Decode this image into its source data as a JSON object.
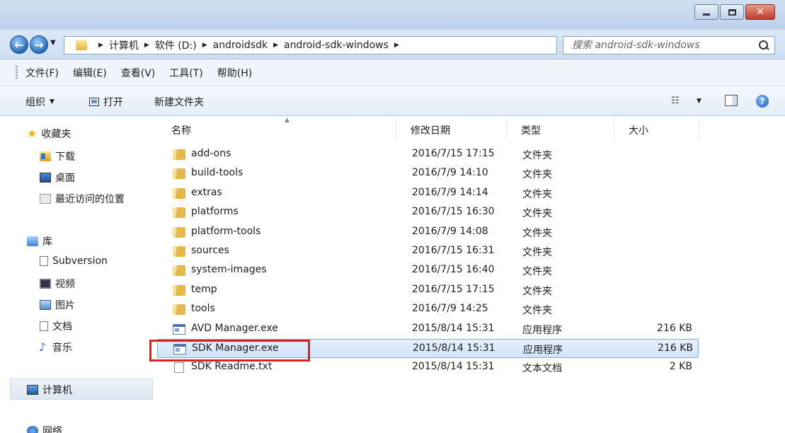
{
  "window": {
    "minimize": "–",
    "maximize": "□",
    "close": "✕"
  },
  "address": {
    "crumbs": [
      "计算机",
      "软件 (D:)",
      "androidsdk",
      "android-sdk-windows"
    ],
    "search_placeholder": "搜索 android-sdk-windows"
  },
  "menu": [
    "文件(F)",
    "编辑(E)",
    "查看(V)",
    "工具(T)",
    "帮助(H)"
  ],
  "toolbar": {
    "organize": "组织",
    "open": "打开",
    "new_folder": "新建文件夹",
    "help": "?"
  },
  "nav": {
    "favorites": "收藏夹",
    "downloads": "下载",
    "desktop": "桌面",
    "recent": "最近访问的位置",
    "libraries": "库",
    "subversion": "Subversion",
    "videos": "视频",
    "pictures": "图片",
    "documents": "文档",
    "music": "音乐",
    "computer": "计算机",
    "network": "网络"
  },
  "columns": {
    "name": "名称",
    "date": "修改日期",
    "type": "类型",
    "size": "大小"
  },
  "files": [
    {
      "icon": "folder-icon",
      "name": "add-ons",
      "date": "2016/7/15 17:15",
      "type": "文件夹",
      "size": ""
    },
    {
      "icon": "folder-icon",
      "name": "build-tools",
      "date": "2016/7/9 14:10",
      "type": "文件夹",
      "size": ""
    },
    {
      "icon": "folder-icon",
      "name": "extras",
      "date": "2016/7/9 14:14",
      "type": "文件夹",
      "size": ""
    },
    {
      "icon": "folder-icon",
      "name": "platforms",
      "date": "2016/7/15 16:30",
      "type": "文件夹",
      "size": ""
    },
    {
      "icon": "folder-icon",
      "name": "platform-tools",
      "date": "2016/7/9 14:08",
      "type": "文件夹",
      "size": ""
    },
    {
      "icon": "folder-icon",
      "name": "sources",
      "date": "2016/7/15 16:31",
      "type": "文件夹",
      "size": ""
    },
    {
      "icon": "folder-icon",
      "name": "system-images",
      "date": "2016/7/15 16:40",
      "type": "文件夹",
      "size": ""
    },
    {
      "icon": "folder-icon",
      "name": "temp",
      "date": "2016/7/15 17:15",
      "type": "文件夹",
      "size": ""
    },
    {
      "icon": "folder-icon",
      "name": "tools",
      "date": "2016/7/9 14:25",
      "type": "文件夹",
      "size": ""
    },
    {
      "icon": "exe-icon",
      "name": "AVD Manager.exe",
      "date": "2015/8/14 15:31",
      "type": "应用程序",
      "size": "216 KB"
    },
    {
      "icon": "exe-icon",
      "name": "SDK Manager.exe",
      "date": "2015/8/14 15:31",
      "type": "应用程序",
      "size": "216 KB"
    },
    {
      "icon": "txt-icon",
      "name": "SDK Readme.txt",
      "date": "2015/8/14 15:31",
      "type": "文本文档",
      "size": "2 KB"
    }
  ],
  "selected_index": 10,
  "colors": {
    "highlight_box": "#e02020",
    "selection": "#cfe3fa"
  }
}
